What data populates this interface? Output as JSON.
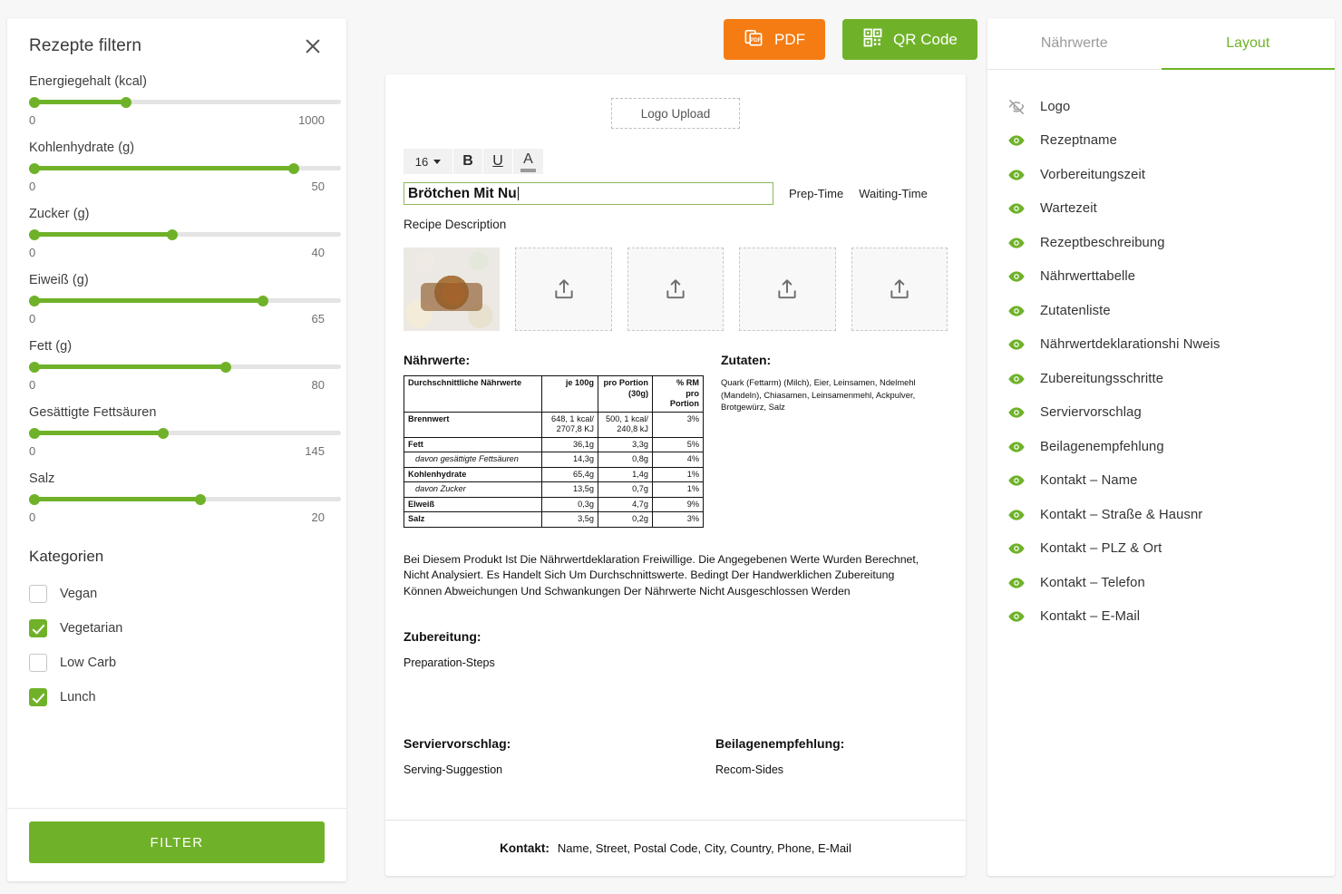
{
  "filter_panel": {
    "title": "Rezepte filtern",
    "close_icon": "close-icon",
    "sliders": [
      {
        "label": "Energiegehalt (kcal)",
        "min": "0",
        "max": "1000",
        "fill_pct": 31
      },
      {
        "label": "Kohlenhydrate (g)",
        "min": "0",
        "max": "50",
        "fill_pct": 85
      },
      {
        "label": "Zucker (g)",
        "min": "0",
        "max": "40",
        "fill_pct": 46
      },
      {
        "label": "Eiweiß (g)",
        "min": "0",
        "max": "65",
        "fill_pct": 75
      },
      {
        "label": "Fett (g)",
        "min": "0",
        "max": "80",
        "fill_pct": 63
      },
      {
        "label": "Gesättigte Fettsäuren",
        "min": "0",
        "max": "145",
        "fill_pct": 43
      },
      {
        "label": "Salz",
        "min": "0",
        "max": "20",
        "fill_pct": 55
      }
    ],
    "categories_title": "Kategorien",
    "categories": [
      {
        "label": "Vegan",
        "checked": false
      },
      {
        "label": "Vegetarian",
        "checked": true
      },
      {
        "label": "Low Carb",
        "checked": false
      },
      {
        "label": "Lunch",
        "checked": true
      }
    ],
    "filter_button": "FILTER"
  },
  "top_actions": {
    "pdf": {
      "label": "PDF",
      "icon": "pdf-file-icon",
      "color": "#f57c13"
    },
    "qr": {
      "label": "QR Code",
      "icon": "qr-code-icon",
      "color": "#6fb229"
    }
  },
  "document": {
    "logo_upload": "Logo Upload",
    "toolbar": {
      "font_size": "16",
      "bold": "B",
      "underline": "U",
      "text_color": "A",
      "caret_icon": "chevron-down-icon"
    },
    "recipe_title": "Brötchen Mit Nu",
    "prep_time_label": "Prep-Time",
    "waiting_time_label": "Waiting-Time",
    "recipe_description": "Recipe Description",
    "image_slots": 4,
    "nutrition_heading": "Nährwerte:",
    "nutrition_table": {
      "headers": [
        "Durchschnittliche Nährwerte",
        "je 100g",
        "pro Portion (30g)",
        "% RM pro Portion"
      ],
      "header_parts": {
        "col1": "Durchschnittliche Nährwerte",
        "col2": "je 100g",
        "col3_line1": "pro Portion",
        "col3_line2": "(30g)",
        "col4_line1": "% RM",
        "col4_line2": "pro Portion"
      },
      "rows": [
        {
          "name": "Brennwert",
          "sub": false,
          "per100_line1": "648, 1 kcal/",
          "per100_line2": "2707,8 KJ",
          "portion_line1": "500, 1 kcal/",
          "portion_line2": "240,8 kJ",
          "rm": "3%"
        },
        {
          "name": "Fett",
          "sub": false,
          "per100_line1": "36,1g",
          "per100_line2": "",
          "portion_line1": "3,3g",
          "portion_line2": "",
          "rm": "5%"
        },
        {
          "name": "davon gesättigte Fettsäuren",
          "sub": true,
          "per100_line1": "14,3g",
          "per100_line2": "",
          "portion_line1": "0,8g",
          "portion_line2": "",
          "rm": "4%"
        },
        {
          "name": "Kohlenhydrate",
          "sub": false,
          "per100_line1": "65,4g",
          "per100_line2": "",
          "portion_line1": "1,4g",
          "portion_line2": "",
          "rm": "1%"
        },
        {
          "name": "davon Zucker",
          "sub": true,
          "per100_line1": "13,5g",
          "per100_line2": "",
          "portion_line1": "0,7g",
          "portion_line2": "",
          "rm": "1%"
        },
        {
          "name": "Elweiß",
          "sub": false,
          "per100_line1": "0,3g",
          "per100_line2": "",
          "portion_line1": "4,7g",
          "portion_line2": "",
          "rm": "9%"
        },
        {
          "name": "Salz",
          "sub": false,
          "per100_line1": "3,5g",
          "per100_line2": "",
          "portion_line1": "0,2g",
          "portion_line2": "",
          "rm": "3%"
        }
      ]
    },
    "ingredients_heading": "Zutaten:",
    "ingredients_text": "Quark (Fettarm) (Milch), Eier, Leinsamen, Ndelmehl (Mandeln), Chiasamen, Leinsamenmehl, Ackpulver, Brotgewürz, Salz",
    "disclaimer": "Bei Diesem Produkt Ist Die Nährwertdeklaration Freiwillige. Die Angegebenen Werte Wurden Berechnet, Nicht Analysiert. Es Handelt Sich Um Durchschnittswerte. Bedingt Der Handwerklichen Zubereitung Können Abweichungen Und Schwankungen Der Nährwerte Nicht Ausgeschlossen Werden",
    "preparation_heading": "Zubereitung:",
    "preparation_body": "Preparation-Steps",
    "serving_heading": "Serviervorschlag:",
    "serving_body": "Serving-Suggestion",
    "sides_heading": "Beilagenempfehlung:",
    "sides_body": "Recom-Sides",
    "contact_label": "Kontakt:",
    "contact_value": "Name, Street, Postal Code, City, Country, Phone, E-Mail"
  },
  "right_panel": {
    "tabs": [
      {
        "label": "Nährwerte",
        "active": false
      },
      {
        "label": "Layout",
        "active": true
      }
    ],
    "items": [
      {
        "label": "Logo",
        "visible": false
      },
      {
        "label": "Rezeptname",
        "visible": true
      },
      {
        "label": "Vorbereitungszeit",
        "visible": true
      },
      {
        "label": "Wartezeit",
        "visible": true
      },
      {
        "label": "Rezeptbeschreibung",
        "visible": true
      },
      {
        "label": "Nährwerttabelle",
        "visible": true
      },
      {
        "label": "Zutatenliste",
        "visible": true
      },
      {
        "label": "Nährwertdeklarationshi Nweis",
        "visible": true
      },
      {
        "label": "Zubereitungsschritte",
        "visible": true
      },
      {
        "label": "Serviervorschlag",
        "visible": true
      },
      {
        "label": "Beilagenempfehlung",
        "visible": true
      },
      {
        "label": "Kontakt – Name",
        "visible": true
      },
      {
        "label": "Kontakt – Straße & Hausnr",
        "visible": true
      },
      {
        "label": "Kontakt – PLZ & Ort",
        "visible": true
      },
      {
        "label": "Kontakt – Telefon",
        "visible": true
      },
      {
        "label": "Kontakt – E-Mail",
        "visible": true
      }
    ]
  },
  "colors": {
    "accent_green": "#6fb229",
    "pdf_orange": "#f57c13",
    "page_bg": "#f7f7f7"
  }
}
